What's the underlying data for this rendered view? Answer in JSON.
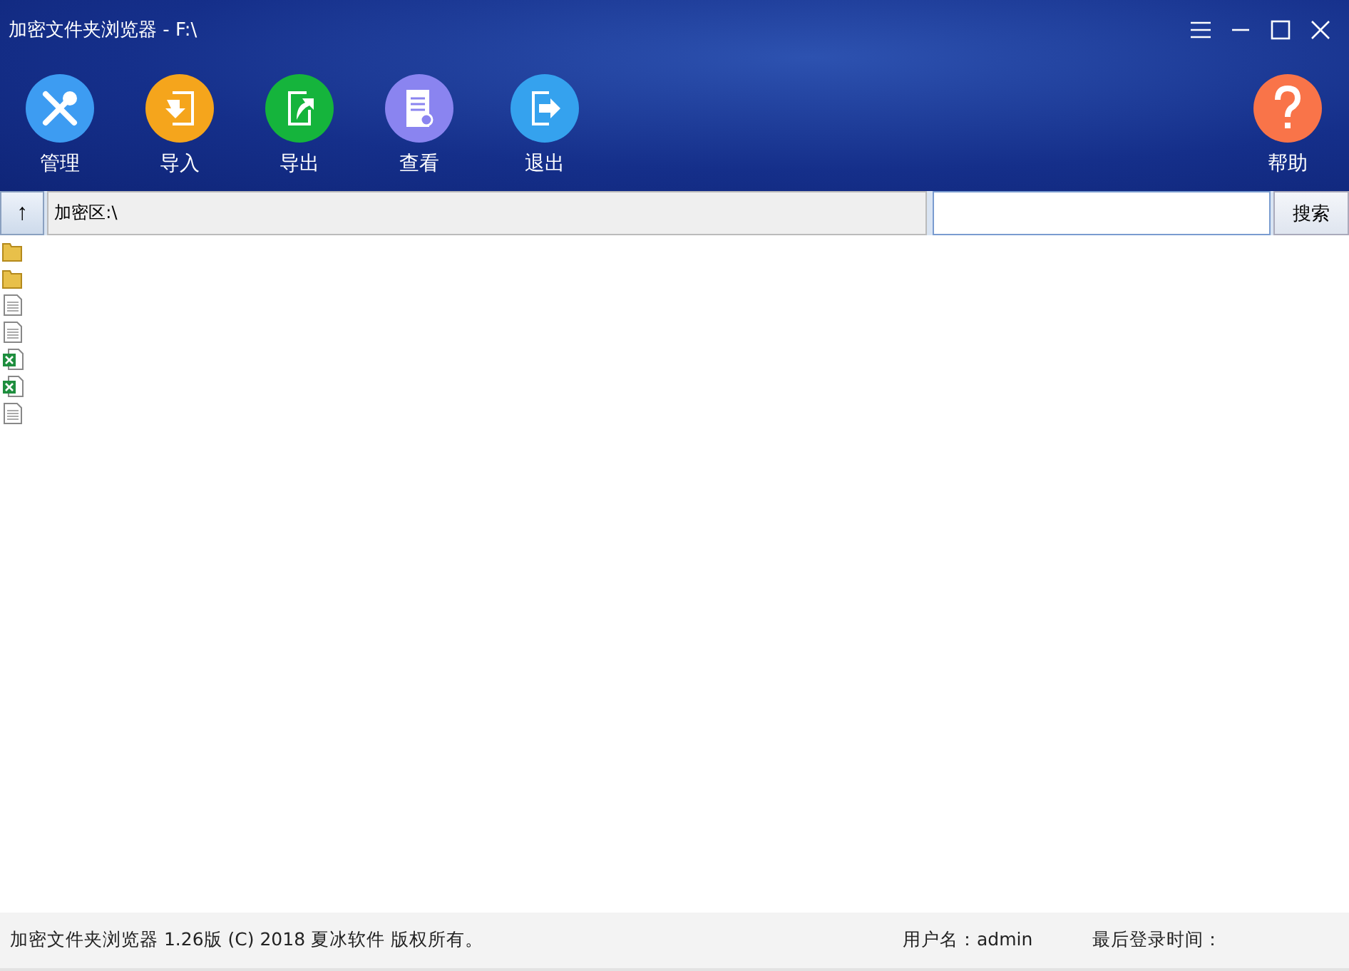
{
  "window": {
    "title": "加密文件夹浏览器  - F:\\"
  },
  "toolbar": [
    {
      "label": "管理",
      "kind": "tools",
      "color": "#3d9cf2"
    },
    {
      "label": "导入",
      "kind": "import",
      "color": "#f5a51c"
    },
    {
      "label": "导出",
      "kind": "export",
      "color": "#15b43c"
    },
    {
      "label": "查看",
      "kind": "view",
      "color": "#8a84f0"
    },
    {
      "label": "退出",
      "kind": "exit",
      "color": "#35a2ee"
    }
  ],
  "help": {
    "label": "帮助",
    "kind": "help",
    "color": "#f97449"
  },
  "up_button": {
    "label": "↑"
  },
  "path": {
    "value": "加密区:\\"
  },
  "search": {
    "button": "搜索"
  },
  "files": [
    {
      "kind": "folder"
    },
    {
      "kind": "folder"
    },
    {
      "kind": "text"
    },
    {
      "kind": "text"
    },
    {
      "kind": "excel"
    },
    {
      "kind": "excel"
    },
    {
      "kind": "text"
    }
  ],
  "status_bar": {
    "copyright": "加密文件夹浏览器  1.26版  (C) 2018 夏冰软件 版权所有。",
    "user": "用户名：admin",
    "last_login": "最后登录时间："
  }
}
